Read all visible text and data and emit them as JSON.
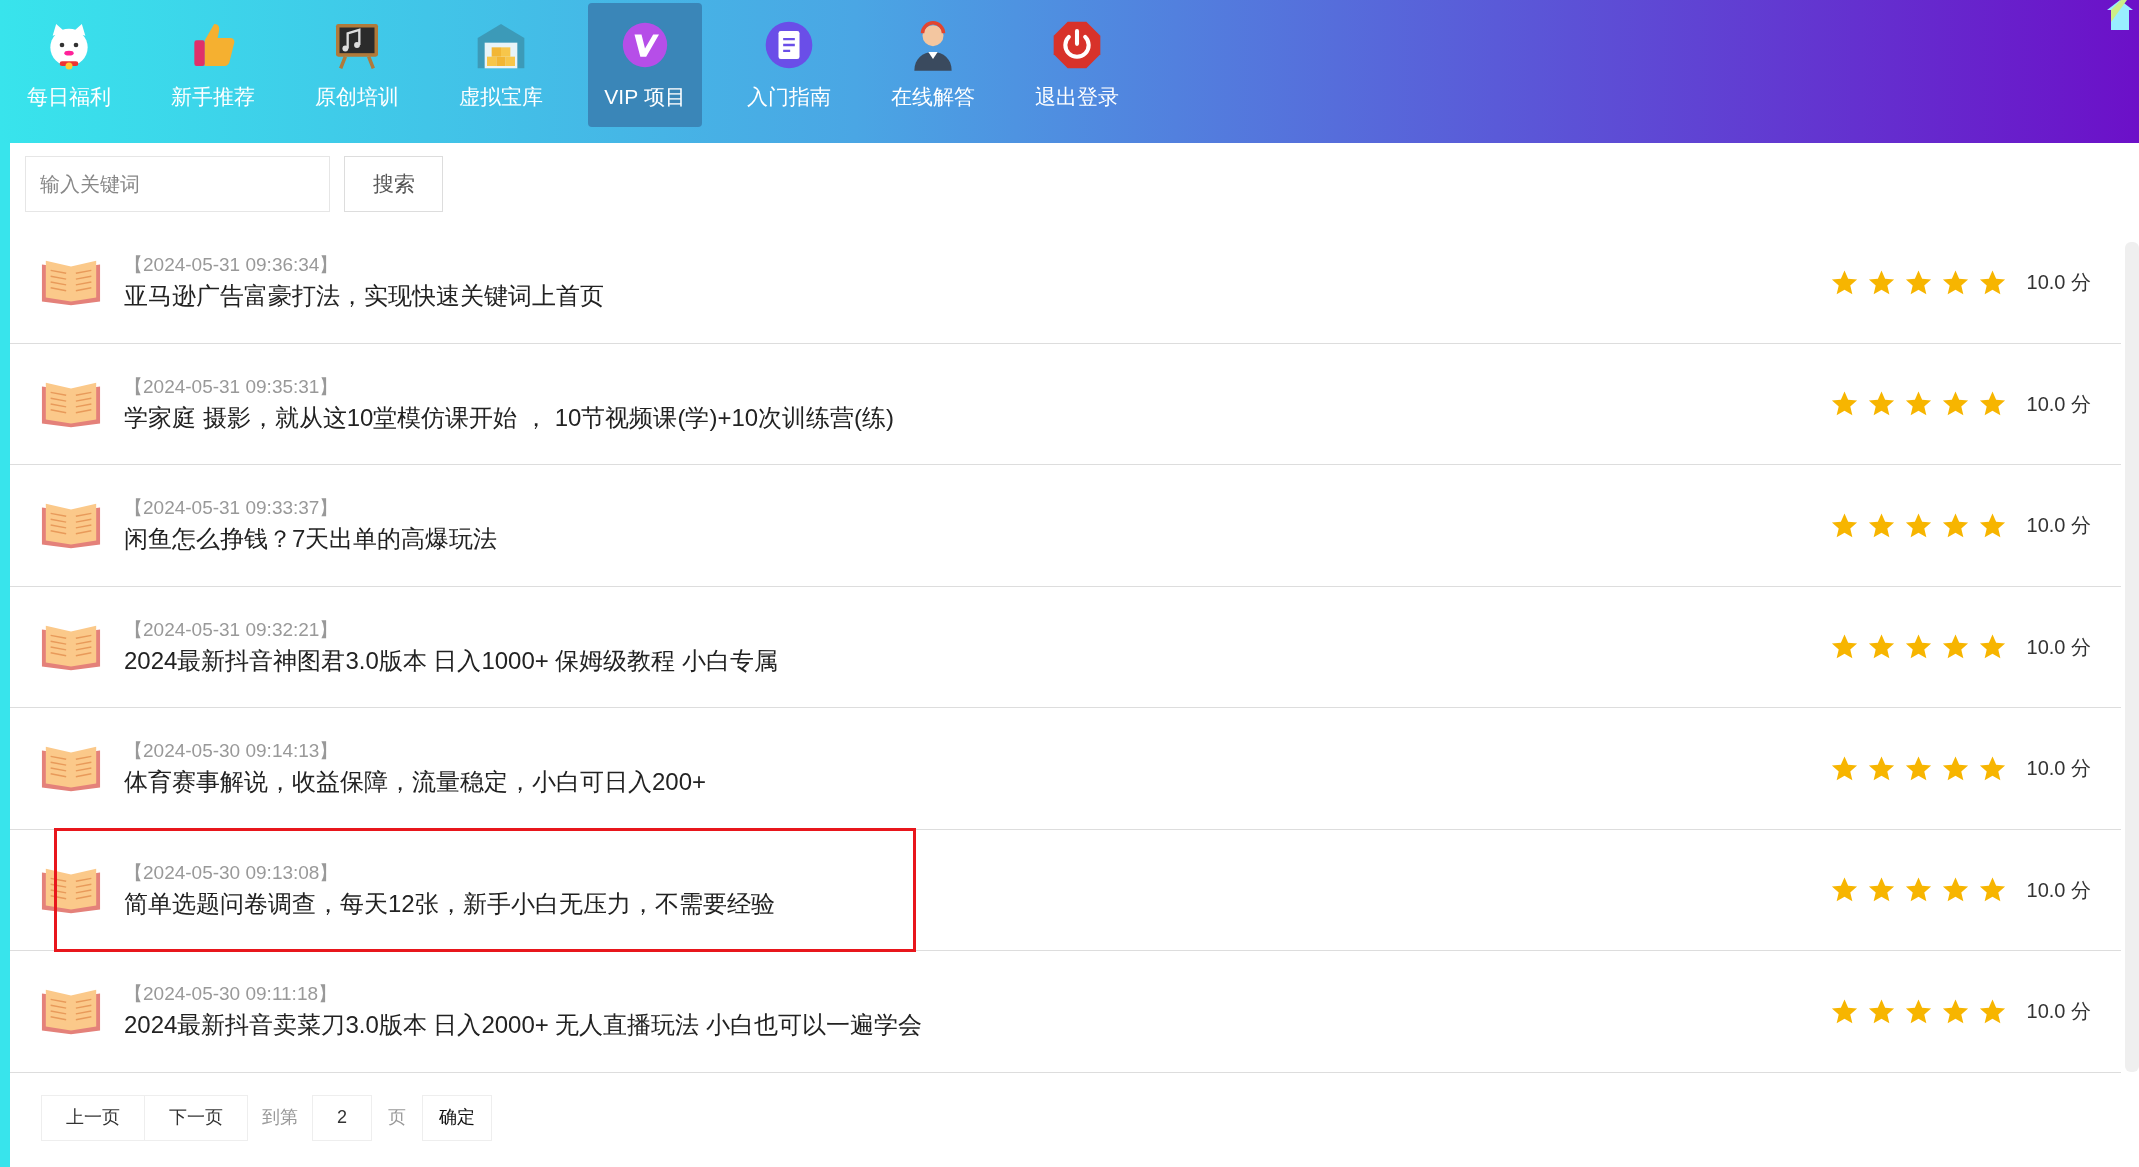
{
  "nav": [
    {
      "label": "每日福利",
      "selected": false
    },
    {
      "label": "新手推荐",
      "selected": false
    },
    {
      "label": "原创培训",
      "selected": false
    },
    {
      "label": "虚拟宝库",
      "selected": false
    },
    {
      "label": "VIP 项目",
      "selected": true
    },
    {
      "label": "入门指南",
      "selected": false
    },
    {
      "label": "在线解答",
      "selected": false
    },
    {
      "label": "退出登录",
      "selected": false
    }
  ],
  "search": {
    "placeholder": "输入关键词",
    "button": "搜索"
  },
  "articles": [
    {
      "date": "【2024-05-31 09:36:34】",
      "title": "亚马逊广告富豪打法，实现快速关键词上首页",
      "stars": 5,
      "score": "10.0 分",
      "highlighted": false
    },
    {
      "date": "【2024-05-31 09:35:31】",
      "title": "学家庭 摄影，就从这10堂模仿课开始 ， 10节视频课(学)+10次训练营(练)",
      "stars": 5,
      "score": "10.0 分",
      "highlighted": false
    },
    {
      "date": "【2024-05-31 09:33:37】",
      "title": "闲鱼怎么挣钱？7天出单的高爆玩法",
      "stars": 5,
      "score": "10.0 分",
      "highlighted": false
    },
    {
      "date": "【2024-05-31 09:32:21】",
      "title": "2024最新抖音神图君3.0版本 日入1000+ 保姆级教程 小白专属",
      "stars": 5,
      "score": "10.0 分",
      "highlighted": false
    },
    {
      "date": "【2024-05-30 09:14:13】",
      "title": "体育赛事解说，收益保障，流量稳定，小白可日入200+",
      "stars": 5,
      "score": "10.0 分",
      "highlighted": false
    },
    {
      "date": "【2024-05-30 09:13:08】",
      "title": "简单选题问卷调查，每天12张，新手小白无压力，不需要经验",
      "stars": 5,
      "score": "10.0 分",
      "highlighted": true
    },
    {
      "date": "【2024-05-30 09:11:18】",
      "title": "2024最新抖音卖菜刀3.0版本 日入2000+ 无人直播玩法 小白也可以一遍学会",
      "stars": 5,
      "score": "10.0 分",
      "highlighted": false
    }
  ],
  "pagination": {
    "prev": "上一页",
    "next": "下一页",
    "goto_label": "到第",
    "page_value": "2",
    "page_suffix": "页",
    "confirm": "确定"
  }
}
